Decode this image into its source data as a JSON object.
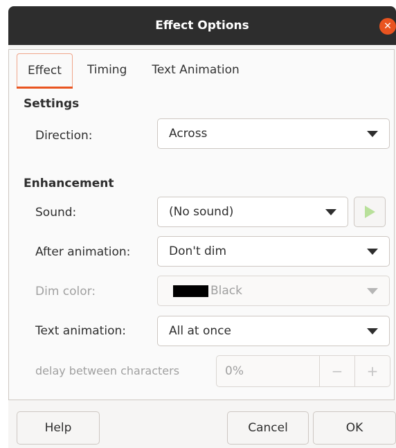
{
  "window": {
    "title": "Effect Options",
    "close_symbol": "✕"
  },
  "tabs": [
    {
      "label": "Effect",
      "active": true
    },
    {
      "label": "Timing",
      "active": false
    },
    {
      "label": "Text Animation",
      "active": false
    }
  ],
  "settings": {
    "heading": "Settings",
    "direction": {
      "label": "Direction:",
      "value": "Across"
    }
  },
  "enhancement": {
    "heading": "Enhancement",
    "sound": {
      "label": "Sound:",
      "value": "(No sound)"
    },
    "after_animation": {
      "label": "After animation:",
      "value": "Don't dim"
    },
    "dim_color": {
      "label": "Dim color:",
      "value": "Black",
      "swatch": "#000000",
      "enabled": false
    },
    "text_animation": {
      "label": "Text animation:",
      "value": "All at once"
    },
    "delay": {
      "label": "delay between characters",
      "value": "0%",
      "minus": "−",
      "plus": "+",
      "enabled": false
    }
  },
  "buttons": {
    "help": "Help",
    "cancel": "Cancel",
    "ok": "OK"
  },
  "colors": {
    "accent": "#e95420",
    "titlebar": "#2d2d2d",
    "play": "#b8e09a"
  }
}
